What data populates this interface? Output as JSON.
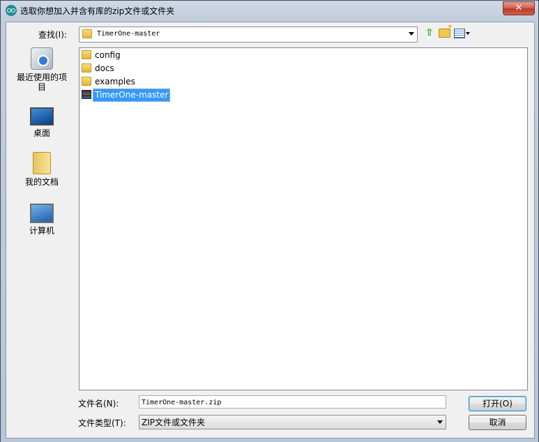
{
  "window": {
    "title": "选取你想加入并含有库的zip文件或文件夹",
    "close_label": "✕"
  },
  "toolbar": {
    "look_in_label": "查找(I):",
    "look_in_value": "TimerOne-master",
    "up_icon": "up-one-level-icon",
    "new_folder_icon": "new-folder-icon",
    "view_icon": "view-menu-icon"
  },
  "places": [
    {
      "label": "最近使用的项目",
      "icon": "recent-items-icon"
    },
    {
      "label": "桌面",
      "icon": "desktop-icon"
    },
    {
      "label": "我的文档",
      "icon": "documents-icon"
    },
    {
      "label": "计算机",
      "icon": "computer-icon"
    }
  ],
  "files": [
    {
      "name": "config",
      "type": "folder"
    },
    {
      "name": "docs",
      "type": "folder"
    },
    {
      "name": "examples",
      "type": "folder"
    },
    {
      "name": "TimerOne-master",
      "type": "zip",
      "selected": true
    }
  ],
  "footer": {
    "filename_label": "文件名(N):",
    "filename_value": "TimerOne-master.zip",
    "filetype_label": "文件类型(T):",
    "filetype_value": "ZIP文件或文件夹",
    "open_label": "打开(O)",
    "cancel_label": "取消"
  }
}
